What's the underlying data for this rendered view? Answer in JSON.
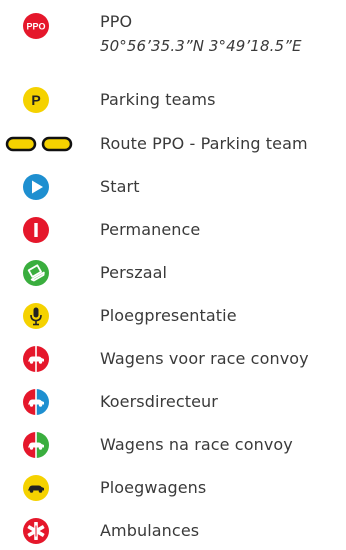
{
  "legend": {
    "items": [
      {
        "label": "PPO",
        "sub": "50°56’35.3”N 3°49’18.5”E",
        "icon": "ppo-marker-icon",
        "badge": "PPO"
      },
      {
        "label": "Parking teams",
        "icon": "parking-marker-icon",
        "badge": "P"
      },
      {
        "label": "Route PPO - Parking team",
        "icon": "route-line-icon"
      },
      {
        "label": "Start",
        "icon": "start-play-icon"
      },
      {
        "label": "Permanence",
        "icon": "permanence-info-icon"
      },
      {
        "label": "Perszaal",
        "icon": "press-room-laptop-icon"
      },
      {
        "label": "Ploegpresentatie",
        "icon": "microphone-icon"
      },
      {
        "label": "Wagens voor race convoy",
        "icon": "car-before-convoy-icon"
      },
      {
        "label": "Koersdirecteur",
        "icon": "race-director-car-icon"
      },
      {
        "label": "Wagens na race convoy",
        "icon": "car-after-convoy-icon"
      },
      {
        "label": "Ploegwagens",
        "icon": "team-car-icon"
      },
      {
        "label": "Ambulances",
        "icon": "ambulance-star-of-life-icon"
      }
    ]
  },
  "colors": {
    "red": "#e5172b",
    "yellow": "#f5d200",
    "blue": "#1e8fd0",
    "green": "#3aae3e",
    "text": "#3a3a3a"
  }
}
